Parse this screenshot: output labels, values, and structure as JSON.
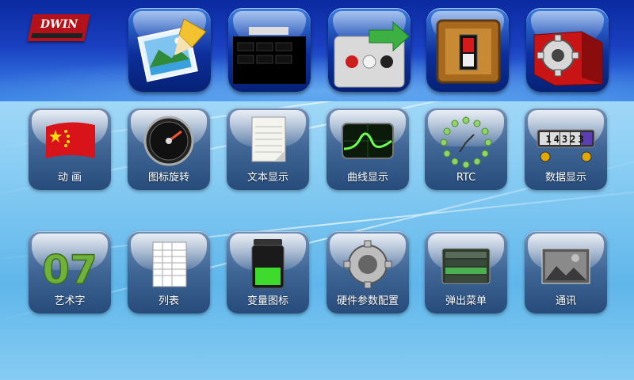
{
  "brand": {
    "logo_text": "DWIN"
  },
  "toolbar": {
    "items": [
      {
        "icon": "picture-pencil-icon"
      },
      {
        "icon": "keyboard-display-icon"
      },
      {
        "icon": "traffic-light-arrow-icon"
      },
      {
        "icon": "power-switch-icon"
      },
      {
        "icon": "gear-box-icon"
      }
    ]
  },
  "menu": {
    "row1": [
      {
        "label": "动 画",
        "icon": "flag-icon"
      },
      {
        "label": "图标旋转",
        "icon": "speedometer-icon"
      },
      {
        "label": "文本显示",
        "icon": "notepad-icon"
      },
      {
        "label": "曲线显示",
        "icon": "oscilloscope-icon"
      },
      {
        "label": "RTC",
        "icon": "clock-icon"
      },
      {
        "label": "数据显示",
        "icon": "counter-icon",
        "counter_digits": "14323"
      }
    ],
    "row2": [
      {
        "label": "艺术字",
        "icon": "art-number-icon",
        "art_text": "07"
      },
      {
        "label": "列表",
        "icon": "spreadsheet-icon"
      },
      {
        "label": "变量图标",
        "icon": "battery-jar-icon"
      },
      {
        "label": "硬件参数配置",
        "icon": "gear-icon"
      },
      {
        "label": "弹出菜单",
        "icon": "popup-menu-icon"
      },
      {
        "label": "通讯",
        "icon": "communication-photo-icon"
      }
    ]
  },
  "colors": {
    "accent": "#0d2f9b",
    "flag_red": "#d8141a",
    "flag_star": "#ffde00",
    "logo_red": "#b3121a"
  }
}
